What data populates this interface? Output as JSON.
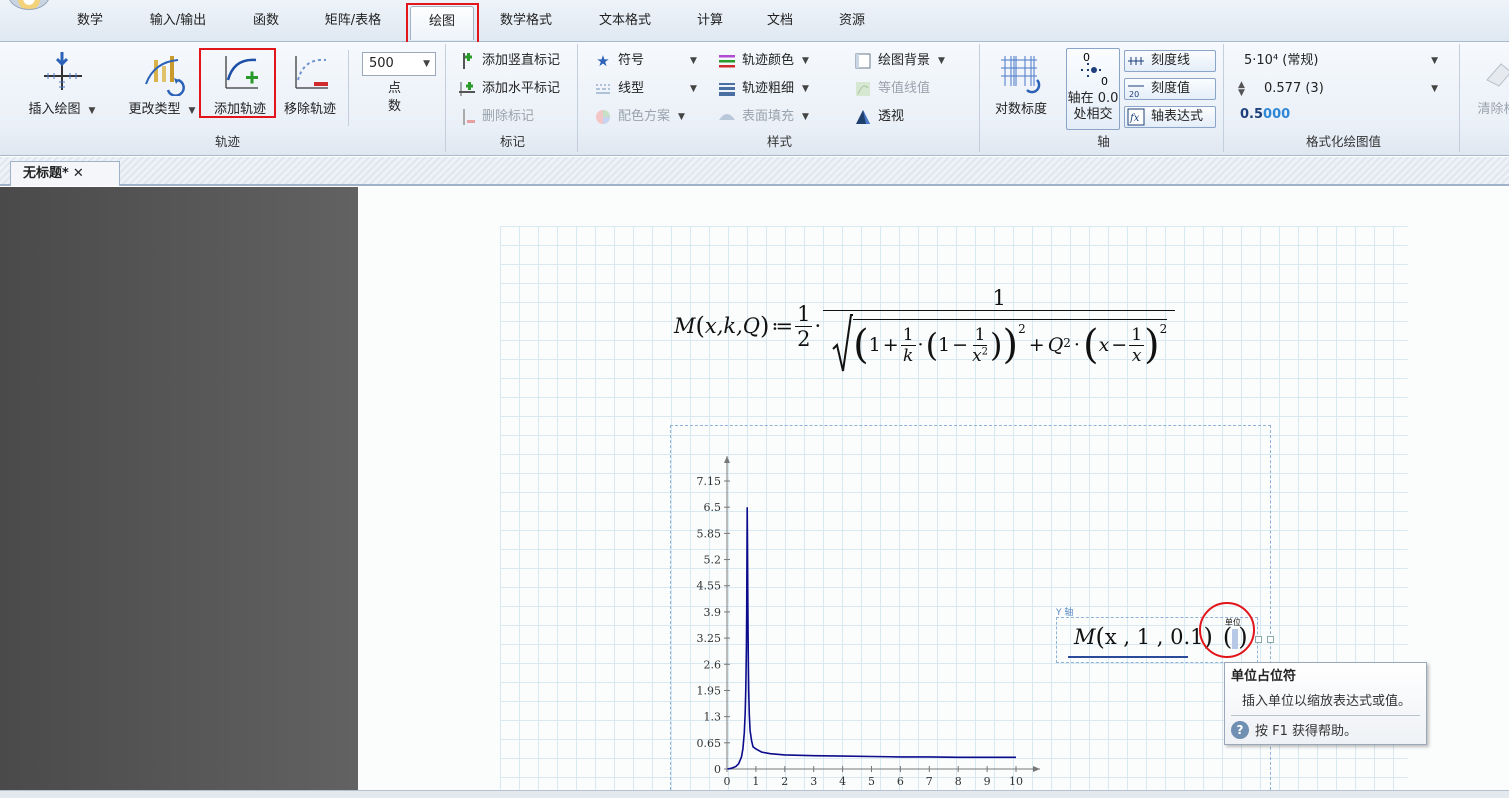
{
  "ribbon_tabs": [
    "数学",
    "输入/输出",
    "函数",
    "矩阵/表格",
    "绘图",
    "数学格式",
    "文本格式",
    "计算",
    "文档",
    "资源"
  ],
  "active_tab": "绘图",
  "groups": {
    "trace": {
      "label": "轨迹",
      "insert_plot": "插入绘图",
      "change_type": "更改类型",
      "add_trace": "添加轨迹",
      "remove_trace": "移除轨迹",
      "points_value": "500",
      "points_label_1": "点",
      "points_label_2": "数"
    },
    "markers": {
      "label": "标记",
      "add_vertical": "添加竖直标记",
      "add_horizontal": "添加水平标记",
      "delete_marker": "删除标记"
    },
    "style": {
      "label": "样式",
      "symbol": "符号",
      "line_type": "线型",
      "color_scheme": "配色方案",
      "trace_color": "轨迹颜色",
      "trace_weight": "轨迹粗细",
      "surface_fill": "表面填充",
      "plot_background": "绘图背景",
      "contour_lines": "等值线值",
      "perspective": "透视"
    },
    "axes": {
      "label": "轴",
      "log_scale": "对数标度",
      "axes_cross_1": "轴在 0.0",
      "axes_cross_2": "处相交",
      "tick_lines": "刻度线",
      "tick_values": "刻度值",
      "axis_expression": "轴表达式"
    },
    "format": {
      "label": "格式化绘图值",
      "number_format": "5·10⁴ (常规)",
      "decimals": "0.577 (3)",
      "sample_black": "0.5",
      "sample_blue": "000",
      "clear": "清除格"
    }
  },
  "document_tab": {
    "title": "无标题*",
    "close": "✕"
  },
  "formula": {
    "lhs_M": "M",
    "lhs_args": "x,k,Q",
    "assign": "≔",
    "half_num": "1",
    "half_den": "2",
    "one": "1",
    "k": "k",
    "x": "x",
    "Q": "Q",
    "two": "2"
  },
  "y_axis": {
    "small_label": "Y 轴",
    "expr_M": "M",
    "expr_args": "x , 1 , 0.1",
    "unit_hint": "单位"
  },
  "tooltip": {
    "title": "单位占位符",
    "body": "插入单位以缩放表达式或值。",
    "help": "按 F1 获得帮助。"
  },
  "colors": {
    "trace": "#0b0b8c",
    "highlight": "#e1151a",
    "grid": "#d5e7f0"
  },
  "chart_data": {
    "type": "line",
    "x_ticks": [
      "0",
      "1",
      "2",
      "3",
      "4",
      "5",
      "6",
      "7",
      "8",
      "9",
      "10"
    ],
    "y_ticks": [
      "0",
      "0.65",
      "1.3",
      "1.95",
      "2.6",
      "3.25",
      "3.9",
      "4.55",
      "5.2",
      "5.85",
      "6.5",
      "7.15"
    ],
    "xlim": [
      0,
      10
    ],
    "ylim": [
      0,
      7.15
    ],
    "series": [
      {
        "x": [
          0.02,
          0.1,
          0.2,
          0.3,
          0.4,
          0.5,
          0.55,
          0.6,
          0.63,
          0.65,
          0.67,
          0.68,
          0.69,
          0.7,
          0.71,
          0.72,
          0.73,
          0.74,
          0.75,
          0.77,
          0.8,
          0.85,
          0.9,
          1.0,
          1.2,
          1.5,
          2,
          3,
          4,
          5,
          6,
          7,
          8,
          9,
          10
        ],
        "y": [
          0.0,
          0.01,
          0.03,
          0.06,
          0.13,
          0.3,
          0.5,
          0.9,
          1.4,
          2.0,
          3.0,
          3.9,
          5.0,
          6.5,
          5.6,
          4.3,
          3.3,
          2.5,
          1.95,
          1.35,
          0.95,
          0.7,
          0.55,
          0.5,
          0.42,
          0.38,
          0.35,
          0.33,
          0.32,
          0.31,
          0.3,
          0.3,
          0.29,
          0.29,
          0.29
        ]
      }
    ],
    "grid": false
  }
}
